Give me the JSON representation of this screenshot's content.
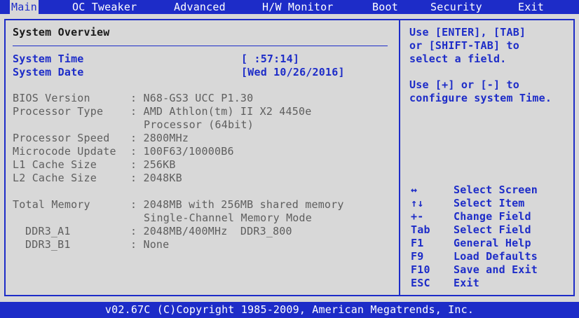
{
  "tabs": [
    "Main",
    "OC Tweaker",
    "Advanced",
    "H/W Monitor",
    "Boot",
    "Security",
    "Exit"
  ],
  "main": {
    "section_title": "System Overview",
    "system_time_label": "System Time",
    "system_time_value": "[ :57:14]",
    "system_date_label": "System Date",
    "system_date_value": "[Wed 10/26/2016]",
    "info": [
      {
        "label": "BIOS Version",
        "value": ": N68-GS3 UCC P1.30"
      },
      {
        "label": "Processor Type",
        "value": ": AMD Athlon(tm) II X2 4450e"
      },
      {
        "label": "",
        "value": "Processor (64bit)"
      },
      {
        "label": "Processor Speed",
        "value": ": 2800MHz"
      },
      {
        "label": "Microcode Update",
        "value": ": 100F63/10000B6"
      },
      {
        "label": "L1 Cache Size",
        "value": ": 256KB"
      },
      {
        "label": "L2 Cache Size",
        "value": ": 2048KB"
      }
    ],
    "memory": [
      {
        "label": "Total Memory",
        "value": ": 2048MB with 256MB shared memory"
      },
      {
        "label": "",
        "value": "Single-Channel Memory Mode"
      },
      {
        "label": "DDR3_A1",
        "value": ": 2048MB/400MHz  DDR3_800"
      },
      {
        "label": "DDR3_B1",
        "value": ": None"
      }
    ]
  },
  "help": {
    "lines": [
      "Use [ENTER], [TAB]",
      "or [SHIFT-TAB] to",
      "select a field.",
      "",
      "Use [+] or [-] to",
      "configure system Time."
    ]
  },
  "keys": [
    {
      "key": "↔",
      "action": "Select Screen"
    },
    {
      "key": "↑↓",
      "action": "Select Item"
    },
    {
      "key": "+-",
      "action": "Change Field"
    },
    {
      "key": "Tab",
      "action": "Select Field"
    },
    {
      "key": "F1",
      "action": "General Help"
    },
    {
      "key": "F9",
      "action": "Load Defaults"
    },
    {
      "key": "F10",
      "action": "Save and Exit"
    },
    {
      "key": "ESC",
      "action": "Exit"
    }
  ],
  "footer": "v02.67C (C)Copyright 1985-2009, American Megatrends, Inc."
}
